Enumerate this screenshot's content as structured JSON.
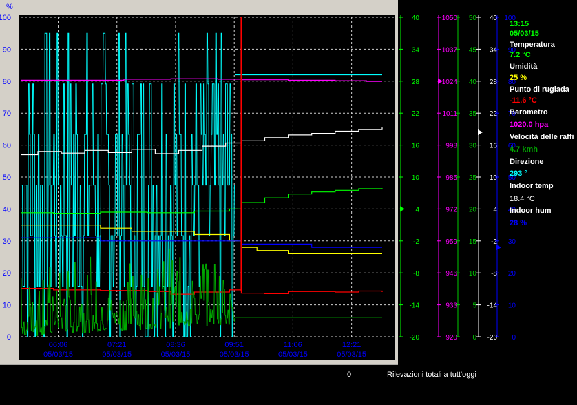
{
  "colors": {
    "background": "#000000",
    "frame": "#d4d0c8",
    "grid": "#ffffff",
    "wind": "#00ffff",
    "pressure": "#ff00ff",
    "indoor_temp": "#ffffff",
    "temperature": "#00ff00",
    "humidity": "#ffff00",
    "indoor_hum": "#0000ff",
    "dew_point": "#ff0000",
    "gust": "#00aa00",
    "cursor": "#ff0000"
  },
  "readout": {
    "time": "13:15",
    "date": "05/03/15",
    "temperatura_label": "Temperatura",
    "temperatura_value": "7.2 °C",
    "umidita_label": "Umidità",
    "umidita_value": "25 %",
    "rugiada_label": "Punto di rugiada",
    "rugiada_value": "-11.6 °C",
    "barometro_label": "Barometro",
    "barometro_value": "1020.0 hpa",
    "vento_label": "Velocità delle raffi",
    "vento_value": "4.7 kmh",
    "direzione_label": "Direzione",
    "direzione_value": "293 °",
    "indoor_temp_label": "Indoor temp",
    "indoor_temp_value": "18.4 °C",
    "indoor_hum_label": "Indoor hum",
    "indoor_hum_value": "28 %"
  },
  "footer": {
    "count": "0",
    "label": "Rilevazioni totali a tutt'oggi"
  },
  "chart_data": {
    "type": "line",
    "x_range": [
      "05/03/15 05:18",
      "05/03/15 13:15"
    ],
    "x_ticks": [
      {
        "time": "06:06",
        "date": "05/03/15"
      },
      {
        "time": "07:21",
        "date": "05/03/15"
      },
      {
        "time": "08:36",
        "date": "05/03/15"
      },
      {
        "time": "09:51",
        "date": "05/03/15"
      },
      {
        "time": "11:06",
        "date": "05/03/15"
      },
      {
        "time": "12:21",
        "date": "05/03/15"
      }
    ],
    "grid": true,
    "axes": [
      {
        "id": "pct",
        "unit": "%",
        "side": "left",
        "ylim": [
          0,
          100
        ],
        "ticks": [
          "0",
          "10",
          "20",
          "30",
          "40",
          "50",
          "60",
          "70",
          "80",
          "90",
          "100"
        ],
        "color": "#ffffff"
      },
      {
        "id": "temp",
        "side": "right",
        "ylim": [
          -20,
          40
        ],
        "ticks": [
          "-20",
          "-14",
          "-8",
          "-2",
          "4",
          "10",
          "16",
          "22",
          "28",
          "34",
          "40"
        ],
        "color": "#00ff00"
      },
      {
        "id": "baro",
        "side": "right",
        "ylim": [
          920,
          1050
        ],
        "ticks": [
          "920",
          "933",
          "946",
          "959",
          "972",
          "985",
          "998",
          "1011",
          "1024",
          "1037",
          "1050"
        ],
        "color": "#ff00ff"
      },
      {
        "id": "wind",
        "side": "right",
        "ylim": [
          0,
          50
        ],
        "ticks": [
          "0",
          "5",
          "10",
          "15",
          "20",
          "25",
          "30",
          "35",
          "40",
          "45",
          "50"
        ],
        "color": "#00cc00"
      },
      {
        "id": "itemp",
        "side": "right",
        "ylim": [
          -20,
          40
        ],
        "ticks": [
          "-20",
          "-14",
          "-8",
          "-2",
          "4",
          "10",
          "16",
          "22",
          "28",
          "34",
          "40"
        ],
        "color": "#ffffff"
      },
      {
        "id": "hum",
        "side": "right",
        "ylim": [
          0,
          100
        ],
        "ticks": [
          "0",
          "10",
          "20",
          "30",
          "40",
          "50",
          "60",
          "70",
          "80",
          "90",
          "100"
        ],
        "color": "#0000ff"
      }
    ],
    "series": [
      {
        "id": "wind_dir",
        "axis": "pct",
        "color": "#00ffff",
        "style": "jagged",
        "x": [
          "05:18",
          "09:52"
        ],
        "y": [
          0,
          95
        ]
      },
      {
        "id": "wind_dir_after",
        "axis": "pct",
        "color": "#00ffff",
        "x": [
          "09:52",
          "13:00"
        ],
        "y": [
          82,
          82
        ]
      },
      {
        "id": "pressure",
        "axis": "baro",
        "color": "#ff00ff",
        "x": [
          "05:18",
          "06:30",
          "07:30",
          "08:30",
          "09:30",
          "10:00",
          "11:00",
          "12:00",
          "12:40",
          "13:00"
        ],
        "y": [
          1024.4,
          1024.4,
          1024.8,
          1025.0,
          1024.8,
          1024.6,
          1024.4,
          1024.2,
          1023.9,
          1023.9
        ]
      },
      {
        "id": "indoor_temp",
        "axis": "itemp",
        "color": "#ffffff",
        "x": [
          "05:18",
          "05:40",
          "06:10",
          "06:40",
          "07:10",
          "07:40",
          "08:10",
          "08:40",
          "09:10",
          "09:40",
          "10:00",
          "10:30",
          "11:00",
          "11:30",
          "12:00",
          "12:30",
          "13:00"
        ],
        "y": [
          14.2,
          14.8,
          14.5,
          15.0,
          14.6,
          15.2,
          14.4,
          15.0,
          15.8,
          16.4,
          16.8,
          17.4,
          17.9,
          18.2,
          18.6,
          18.9,
          19.3
        ]
      },
      {
        "id": "temperature",
        "axis": "temp",
        "color": "#00ff00",
        "x": [
          "05:18",
          "06:00",
          "07:00",
          "08:00",
          "09:00",
          "09:45",
          "10:00",
          "10:30",
          "11:00",
          "11:30",
          "12:00",
          "12:30",
          "13:00"
        ],
        "y": [
          3.3,
          3.2,
          3.4,
          3.3,
          3.6,
          4.0,
          5.2,
          6.1,
          6.8,
          7.2,
          7.5,
          7.8,
          7.9
        ]
      },
      {
        "id": "humidity",
        "axis": "pct",
        "color": "#ffff00",
        "x": [
          "05:18",
          "06:00",
          "07:00",
          "07:40",
          "08:20",
          "09:00",
          "09:45",
          "10:00",
          "10:20",
          "11:00",
          "11:30",
          "12:00",
          "12:30",
          "13:00"
        ],
        "y": [
          35,
          35,
          34,
          33,
          33,
          32,
          30,
          28,
          27,
          26,
          26,
          26,
          26,
          26
        ]
      },
      {
        "id": "indoor_hum",
        "axis": "hum",
        "color": "#0000ff",
        "x": [
          "05:18",
          "06:00",
          "07:00",
          "08:00",
          "09:00",
          "09:45",
          "10:00",
          "10:30",
          "11:00",
          "11:30",
          "12:00",
          "12:30",
          "13:00"
        ],
        "y": [
          31,
          31,
          30,
          30,
          30,
          30,
          29,
          29,
          29,
          28,
          28,
          28,
          28
        ]
      },
      {
        "id": "dew_point",
        "axis": "temp",
        "color": "#ff0000",
        "x": [
          "05:18",
          "06:00",
          "07:00",
          "08:00",
          "08:30",
          "09:00",
          "09:45",
          "10:00",
          "10:30",
          "11:00",
          "11:30",
          "12:00",
          "12:30",
          "13:00"
        ],
        "y": [
          -10.9,
          -11.2,
          -11.3,
          -11.5,
          -12.0,
          -11.6,
          -11.2,
          -11.8,
          -11.9,
          -11.5,
          -11.5,
          -11.6,
          -11.4,
          -11.6
        ]
      },
      {
        "id": "gust",
        "axis": "wind",
        "color": "#00aa00",
        "style": "jagged",
        "x": [
          "05:18",
          "09:52"
        ],
        "y": [
          0,
          14
        ]
      },
      {
        "id": "gust_after",
        "axis": "wind",
        "color": "#00aa00",
        "x": [
          "09:52",
          "13:00"
        ],
        "y": [
          3,
          3
        ]
      }
    ],
    "cursor": {
      "time": "10:00"
    }
  }
}
